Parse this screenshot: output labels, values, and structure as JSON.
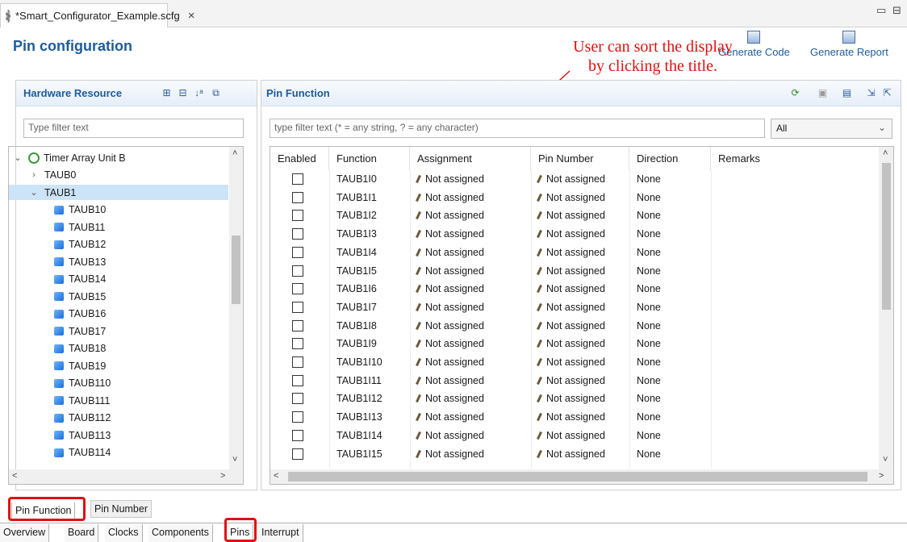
{
  "editor_tab": {
    "title": "*Smart_Configurator_Example.scfg",
    "close": "×"
  },
  "window_controls": {
    "minimize": "▭",
    "maximize": "⊟"
  },
  "header": {
    "title": "Pin configuration",
    "generate_code": "Generate Code",
    "generate_report": "Generate Report"
  },
  "annotation": {
    "line1": "User can sort the display",
    "line2": "by clicking the title."
  },
  "hardware_panel": {
    "title": "Hardware Resource",
    "filter_placeholder": "Type filter text",
    "tree": [
      {
        "label": "Timer Array Unit B",
        "level": 0,
        "expanded": true,
        "icon": "timer-icon"
      },
      {
        "label": "TAUB0",
        "level": 1,
        "expanded": false
      },
      {
        "label": "TAUB1",
        "level": 1,
        "expanded": true,
        "selected": true
      },
      {
        "label": "TAUB10",
        "level": 2
      },
      {
        "label": "TAUB11",
        "level": 2
      },
      {
        "label": "TAUB12",
        "level": 2
      },
      {
        "label": "TAUB13",
        "level": 2
      },
      {
        "label": "TAUB14",
        "level": 2
      },
      {
        "label": "TAUB15",
        "level": 2
      },
      {
        "label": "TAUB16",
        "level": 2
      },
      {
        "label": "TAUB17",
        "level": 2
      },
      {
        "label": "TAUB18",
        "level": 2
      },
      {
        "label": "TAUB19",
        "level": 2
      },
      {
        "label": "TAUB110",
        "level": 2
      },
      {
        "label": "TAUB111",
        "level": 2
      },
      {
        "label": "TAUB112",
        "level": 2
      },
      {
        "label": "TAUB113",
        "level": 2
      },
      {
        "label": "TAUB114",
        "level": 2
      }
    ]
  },
  "pin_panel": {
    "title": "Pin Function",
    "filter_placeholder": "type filter text (* = any string, ? = any character)",
    "filter_select": "All",
    "columns": [
      "Enabled",
      "Function",
      "Assignment",
      "Pin Number",
      "Direction",
      "Remarks"
    ],
    "rows": [
      {
        "function": "TAUB1I0",
        "assignment": "Not assigned",
        "pin": "Not assigned",
        "direction": "None"
      },
      {
        "function": "TAUB1I1",
        "assignment": "Not assigned",
        "pin": "Not assigned",
        "direction": "None"
      },
      {
        "function": "TAUB1I2",
        "assignment": "Not assigned",
        "pin": "Not assigned",
        "direction": "None"
      },
      {
        "function": "TAUB1I3",
        "assignment": "Not assigned",
        "pin": "Not assigned",
        "direction": "None"
      },
      {
        "function": "TAUB1I4",
        "assignment": "Not assigned",
        "pin": "Not assigned",
        "direction": "None"
      },
      {
        "function": "TAUB1I5",
        "assignment": "Not assigned",
        "pin": "Not assigned",
        "direction": "None"
      },
      {
        "function": "TAUB1I6",
        "assignment": "Not assigned",
        "pin": "Not assigned",
        "direction": "None"
      },
      {
        "function": "TAUB1I7",
        "assignment": "Not assigned",
        "pin": "Not assigned",
        "direction": "None"
      },
      {
        "function": "TAUB1I8",
        "assignment": "Not assigned",
        "pin": "Not assigned",
        "direction": "None"
      },
      {
        "function": "TAUB1I9",
        "assignment": "Not assigned",
        "pin": "Not assigned",
        "direction": "None"
      },
      {
        "function": "TAUB1I10",
        "assignment": "Not assigned",
        "pin": "Not assigned",
        "direction": "None"
      },
      {
        "function": "TAUB1I11",
        "assignment": "Not assigned",
        "pin": "Not assigned",
        "direction": "None"
      },
      {
        "function": "TAUB1I12",
        "assignment": "Not assigned",
        "pin": "Not assigned",
        "direction": "None"
      },
      {
        "function": "TAUB1I13",
        "assignment": "Not assigned",
        "pin": "Not assigned",
        "direction": "None"
      },
      {
        "function": "TAUB1I14",
        "assignment": "Not assigned",
        "pin": "Not assigned",
        "direction": "None"
      },
      {
        "function": "TAUB1I15",
        "assignment": "Not assigned",
        "pin": "Not assigned",
        "direction": "None"
      }
    ]
  },
  "view_tabs": {
    "pin_function": "Pin Function",
    "pin_number": "Pin Number"
  },
  "nav_tabs": [
    "Overview",
    "Board",
    "Clocks",
    "Components",
    "Pins",
    "Interrupt"
  ],
  "highlight_color": "#e01010"
}
